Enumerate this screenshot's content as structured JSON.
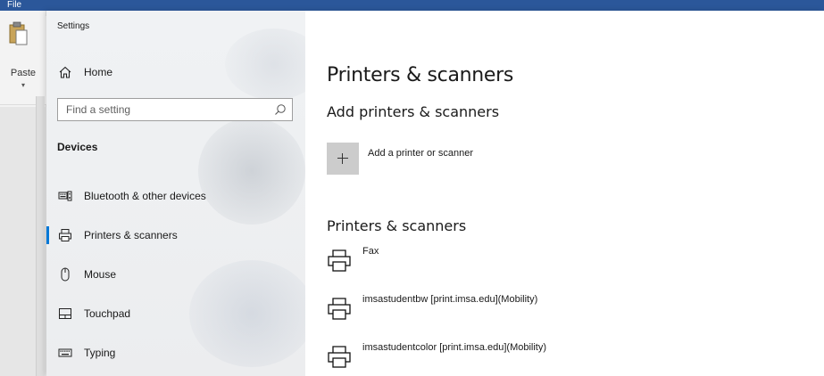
{
  "background_app": {
    "file_tab": "File",
    "paste_label": "Paste"
  },
  "settings": {
    "window_title": "Settings",
    "home_label": "Home",
    "search_placeholder": "Find a setting",
    "section_label": "Devices",
    "nav_items": [
      {
        "label": "Bluetooth & other devices",
        "icon": "keyboard-device-icon",
        "selected": false
      },
      {
        "label": "Printers & scanners",
        "icon": "printer-icon",
        "selected": true
      },
      {
        "label": "Mouse",
        "icon": "mouse-icon",
        "selected": false
      },
      {
        "label": "Touchpad",
        "icon": "touchpad-icon",
        "selected": false
      },
      {
        "label": "Typing",
        "icon": "keyboard-icon",
        "selected": false
      }
    ],
    "accent_color": "#0078d7"
  },
  "main": {
    "page_title": "Printers & scanners",
    "add_section_title": "Add printers & scanners",
    "add_button_label": "Add a printer or scanner",
    "list_section_title": "Printers & scanners",
    "printers": [
      {
        "name": "Fax"
      },
      {
        "name": "imsastudentbw [print.imsa.edu](Mobility)"
      },
      {
        "name": "imsastudentcolor [print.imsa.edu](Mobility)"
      }
    ]
  }
}
